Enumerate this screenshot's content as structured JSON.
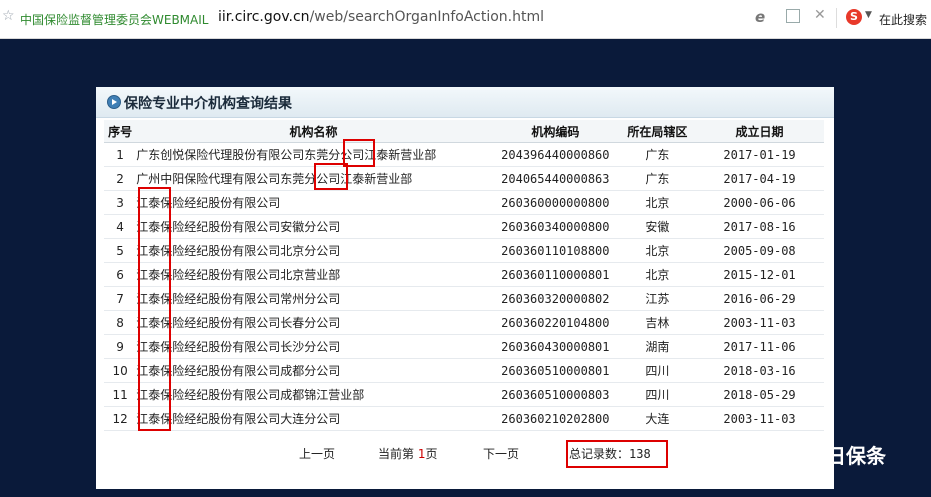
{
  "browser": {
    "site_title": "中国保险监督管理委员会WEBMAIL",
    "url_domain": "iir.circ.gov.cn",
    "url_path": "/web/searchOrganInfoAction.html",
    "search_label": "在此搜索"
  },
  "panel": {
    "title": "保险专业中介机构查询结果",
    "columns": [
      "序号",
      "机构名称",
      "机构编码",
      "所在局辖区",
      "成立日期"
    ],
    "rows": [
      {
        "idx": "1",
        "name": "广东创悦保险代理股份有限公司东莞分公司江泰新营业部",
        "code": "204396440000860",
        "region": "广东",
        "date": "2017-01-19"
      },
      {
        "idx": "2",
        "name": "广州中阳保险代理有限公司东莞分公司江泰新营业部",
        "code": "204065440000863",
        "region": "广东",
        "date": "2017-04-19"
      },
      {
        "idx": "3",
        "name": "江泰保险经纪股份有限公司",
        "code": "260360000000800",
        "region": "北京",
        "date": "2000-06-06"
      },
      {
        "idx": "4",
        "name": "江泰保险经纪股份有限公司安徽分公司",
        "code": "260360340000800",
        "region": "安徽",
        "date": "2017-08-16"
      },
      {
        "idx": "5",
        "name": "江泰保险经纪股份有限公司北京分公司",
        "code": "260360110108800",
        "region": "北京",
        "date": "2005-09-08"
      },
      {
        "idx": "6",
        "name": "江泰保险经纪股份有限公司北京营业部",
        "code": "260360110000801",
        "region": "北京",
        "date": "2015-12-01"
      },
      {
        "idx": "7",
        "name": "江泰保险经纪股份有限公司常州分公司",
        "code": "260360320000802",
        "region": "江苏",
        "date": "2016-06-29"
      },
      {
        "idx": "8",
        "name": "江泰保险经纪股份有限公司长春分公司",
        "code": "260360220104800",
        "region": "吉林",
        "date": "2003-11-03"
      },
      {
        "idx": "9",
        "name": "江泰保险经纪股份有限公司长沙分公司",
        "code": "260360430000801",
        "region": "湖南",
        "date": "2017-11-06"
      },
      {
        "idx": "10",
        "name": "江泰保险经纪股份有限公司成都分公司",
        "code": "260360510000801",
        "region": "四川",
        "date": "2018-03-16"
      },
      {
        "idx": "11",
        "name": "江泰保险经纪股份有限公司成都锦江营业部",
        "code": "260360510000803",
        "region": "四川",
        "date": "2018-05-29"
      },
      {
        "idx": "12",
        "name": "江泰保险经纪股份有限公司大连分公司",
        "code": "260360210202800",
        "region": "大连",
        "date": "2003-11-03"
      }
    ]
  },
  "pager": {
    "prev": "上一页",
    "current_prefix": "当前第 ",
    "current_page": "1",
    "current_suffix": "页",
    "next": "下一页",
    "total_label": "总记录数：",
    "total_count": "138"
  },
  "watermark": {
    "text": "今日保条"
  },
  "colors": {
    "background": "#0a1a3a",
    "highlight": "#dd0000",
    "site_green": "#2f8a2f"
  }
}
